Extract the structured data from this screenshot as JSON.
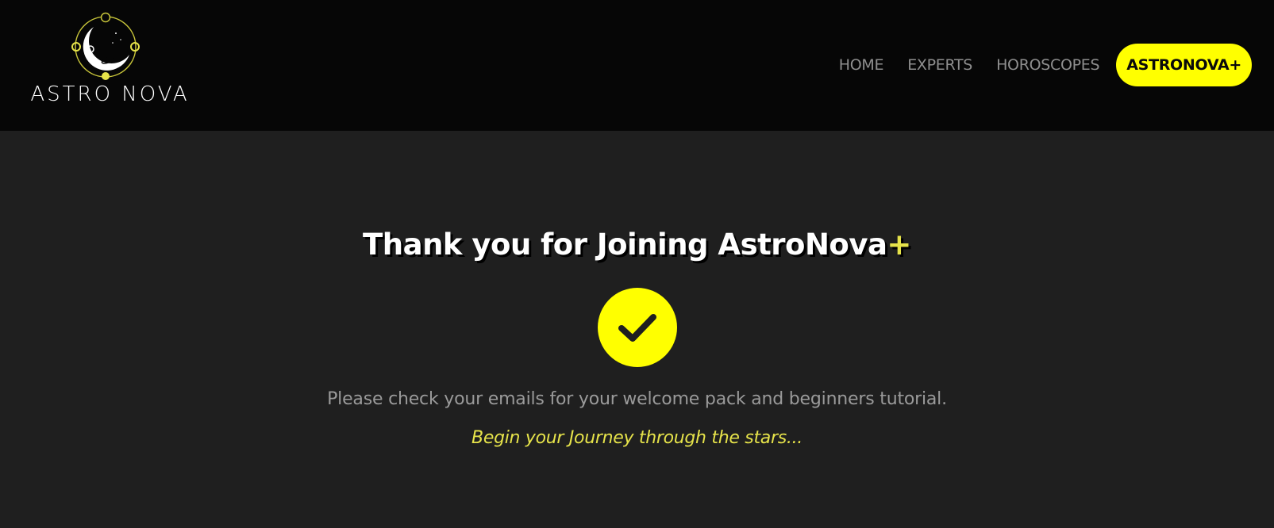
{
  "header": {
    "logo_text": "ASTRO NOVA",
    "logo_icon": "moon-astronaut-logo",
    "nav_items": [
      "HOME",
      "EXPERTS",
      "HOROSCOPES"
    ],
    "cta_label": "ASTRONOVA+"
  },
  "main": {
    "title": "Thank you for Joining AstroNova",
    "title_accent": "+",
    "status_icon": "check-icon",
    "message": "Please check your emails for your welcome pack and beginners tutorial.",
    "tagline": "Begin your Journey through the stars..."
  },
  "colors": {
    "header_bg": "#060606",
    "page_bg": "#1f1f1f",
    "accent_yellow": "#ffff00",
    "accent_text_yellow": "#e6e34a",
    "nav_text": "#8f8f8f",
    "message_text": "#9a9a9a"
  }
}
